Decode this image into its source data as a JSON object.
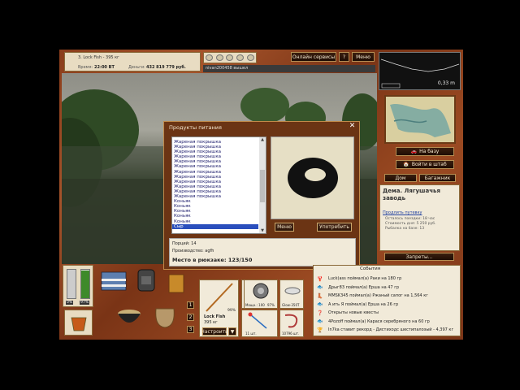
{
  "top_bar": {
    "nickname": "3. Lock Fish - 395 кг",
    "time_label": "Время:",
    "time_value": "22:00 ВТ",
    "money_label": "Деньги:",
    "money_value": "432 819 779 руб.",
    "online_services": "Онлайн сервисы",
    "help": "?",
    "menu": "Меню",
    "chat_message": "nivan200458 вышел"
  },
  "depth": {
    "value": "0,33 m"
  },
  "dialog": {
    "title": "Продукты питания",
    "items": [
      "Жареная покрышка",
      "Жареная покрышка",
      "Жареная покрышка",
      "Жареная покрышка",
      "Жареная покрышка",
      "Жареная покрышка",
      "Жареная покрышка",
      "Жареная покрышка",
      "Жареная покрышка",
      "Жареная покрышка",
      "Жареная покрышка",
      "Жареная покрышка",
      "Коньяк",
      "Коньяк",
      "Коньяк",
      "Коньяк",
      "Коньяк",
      "Сыр"
    ],
    "menu_button": "Меню",
    "use_button": "Употребить",
    "portions_label": "Порций: 14",
    "producer_label": "Производство: agfh",
    "backpack_label": "Место в рюкзаке: 123/150"
  },
  "right_panel": {
    "to_base": "На базу",
    "to_hq": "Войти в штаб",
    "home": "Дом",
    "luggage": "Багажник",
    "location_title": "Дема. Лягушачья заводь",
    "extend_link": "Продлить путевку",
    "left_label": "Осталось поездки: 18 час",
    "cost_label": "Стоимость дня: 5 250 руб.",
    "fishing_label": "Рыбалка на базе: 13",
    "bans": "Запреты..."
  },
  "gauges": {
    "left": "0%",
    "right": "97%"
  },
  "bottom": {
    "slot1": "1",
    "slot2": "2",
    "slot3": "3",
    "rod_name": "Lock Fish",
    "rod_weight": "395 кг",
    "rod_pct": "99%",
    "reel_left": "Мощн.: 100",
    "reel_right": "97%",
    "bait_name": "Glow-350Т",
    "tackle_count": "11 шт.",
    "worm_count": "10796 шт.",
    "settings": "Настроить"
  },
  "events": {
    "title": "События",
    "rows": [
      "Luck(ass поймал(а) Раки на 180 гр",
      "Дрыг83 поймал(а) Ерша на 47 гр",
      "MMSK345 поймал(а) Ржаный сапог на 1,564 кг",
      "A ить Я поймал(а) Ерша на 26 гр",
      "Открыты новые квесты",
      "4Pozoff поймал(а) Карася серебряного на 60 гр",
      "In7ka ставит рекорд - Дистиходс шестипалозый - 4,397 кг"
    ]
  },
  "colors": {
    "wood": "#8a3d1b",
    "selection": "#2a4fbd",
    "dialog_title": "#f4e7cf"
  }
}
